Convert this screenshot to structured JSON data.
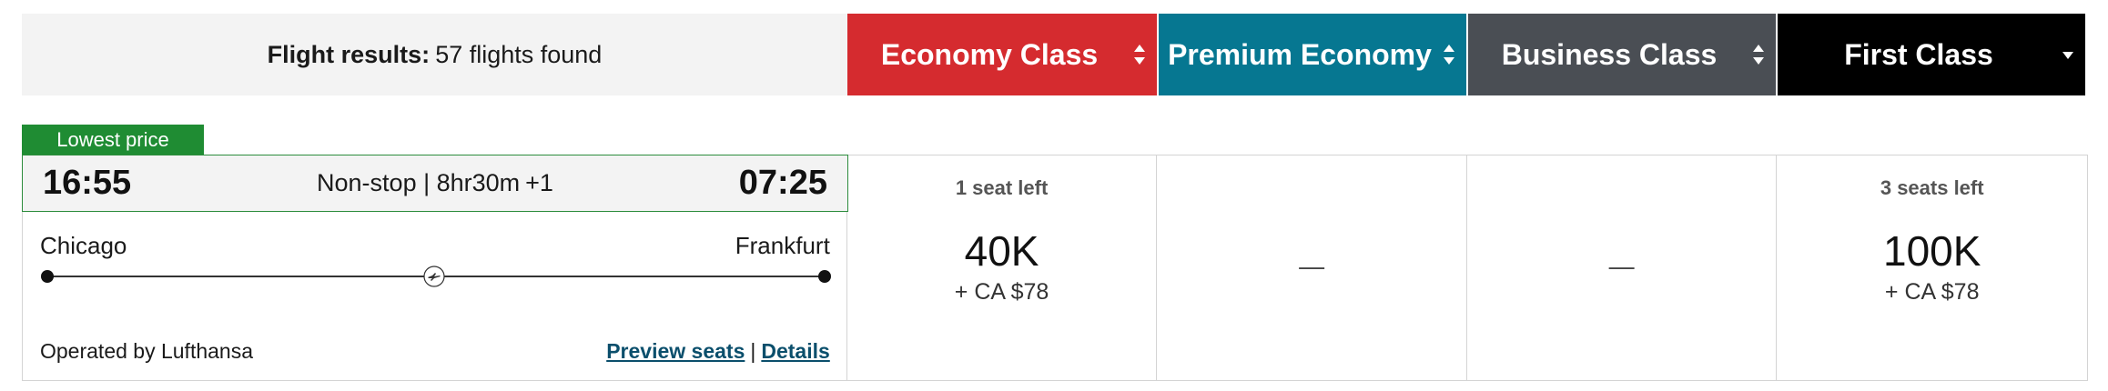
{
  "header": {
    "results_label": "Flight results:",
    "results_count": "57 flights found",
    "tabs": [
      {
        "label": "Economy Class",
        "color": "#d52b2f",
        "sort_icon": "sort-updown-icon"
      },
      {
        "label": "Premium Economy",
        "color": "#067791",
        "sort_icon": "sort-updown-icon"
      },
      {
        "label": "Business Class",
        "color": "#4a4e54",
        "sort_icon": "sort-updown-icon"
      },
      {
        "label": "First Class",
        "color": "#000000",
        "sort_icon": "sort-down-icon"
      }
    ]
  },
  "flight": {
    "badge": "Lowest price",
    "depart_time": "16:55",
    "duration": "Non-stop | 8hr30m",
    "day_offset": "+1",
    "arrive_time": "07:25",
    "origin": "Chicago",
    "destination": "Frankfurt",
    "airline_icon": "lufthansa-crane-icon",
    "operated_by": "Operated by Lufthansa",
    "preview_seats": "Preview seats",
    "separator": "|",
    "details": "Details",
    "fares": [
      {
        "seats_left": "1 seat left",
        "points": "40K",
        "taxes": "+ CA $78"
      },
      {
        "unavailable": "—"
      },
      {
        "unavailable": "—"
      },
      {
        "seats_left": "3 seats left",
        "points": "100K",
        "taxes": "+ CA $78"
      }
    ]
  }
}
